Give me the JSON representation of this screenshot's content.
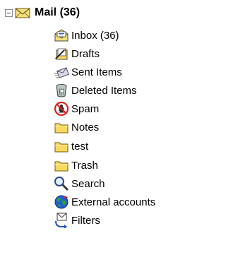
{
  "root": {
    "label": "Mail (36)",
    "icon": "envelope-icon",
    "expander": "collapse-minus-icon",
    "expanded": true
  },
  "folders": [
    {
      "label": "Inbox (36)",
      "icon": "inbox-icon"
    },
    {
      "label": "Drafts",
      "icon": "drafts-icon"
    },
    {
      "label": "Sent Items",
      "icon": "sent-items-icon"
    },
    {
      "label": "Deleted Items",
      "icon": "trash-can-icon"
    },
    {
      "label": "Spam",
      "icon": "spam-bug-icon"
    },
    {
      "label": "Notes",
      "icon": "folder-icon"
    },
    {
      "label": "test",
      "icon": "folder-icon"
    },
    {
      "label": "Trash",
      "icon": "folder-icon"
    },
    {
      "label": "Search",
      "icon": "magnifier-icon"
    },
    {
      "label": "External accounts",
      "icon": "globe-icon"
    },
    {
      "label": "Filters",
      "icon": "filter-envelope-icon"
    }
  ],
  "colors": {
    "folder_fill": "#f8d860",
    "folder_stroke": "#7a5a00",
    "envelope_fill": "#f4e07a",
    "spam_red": "#e02020",
    "globe_blue": "#2060d0",
    "globe_green": "#30a030"
  }
}
